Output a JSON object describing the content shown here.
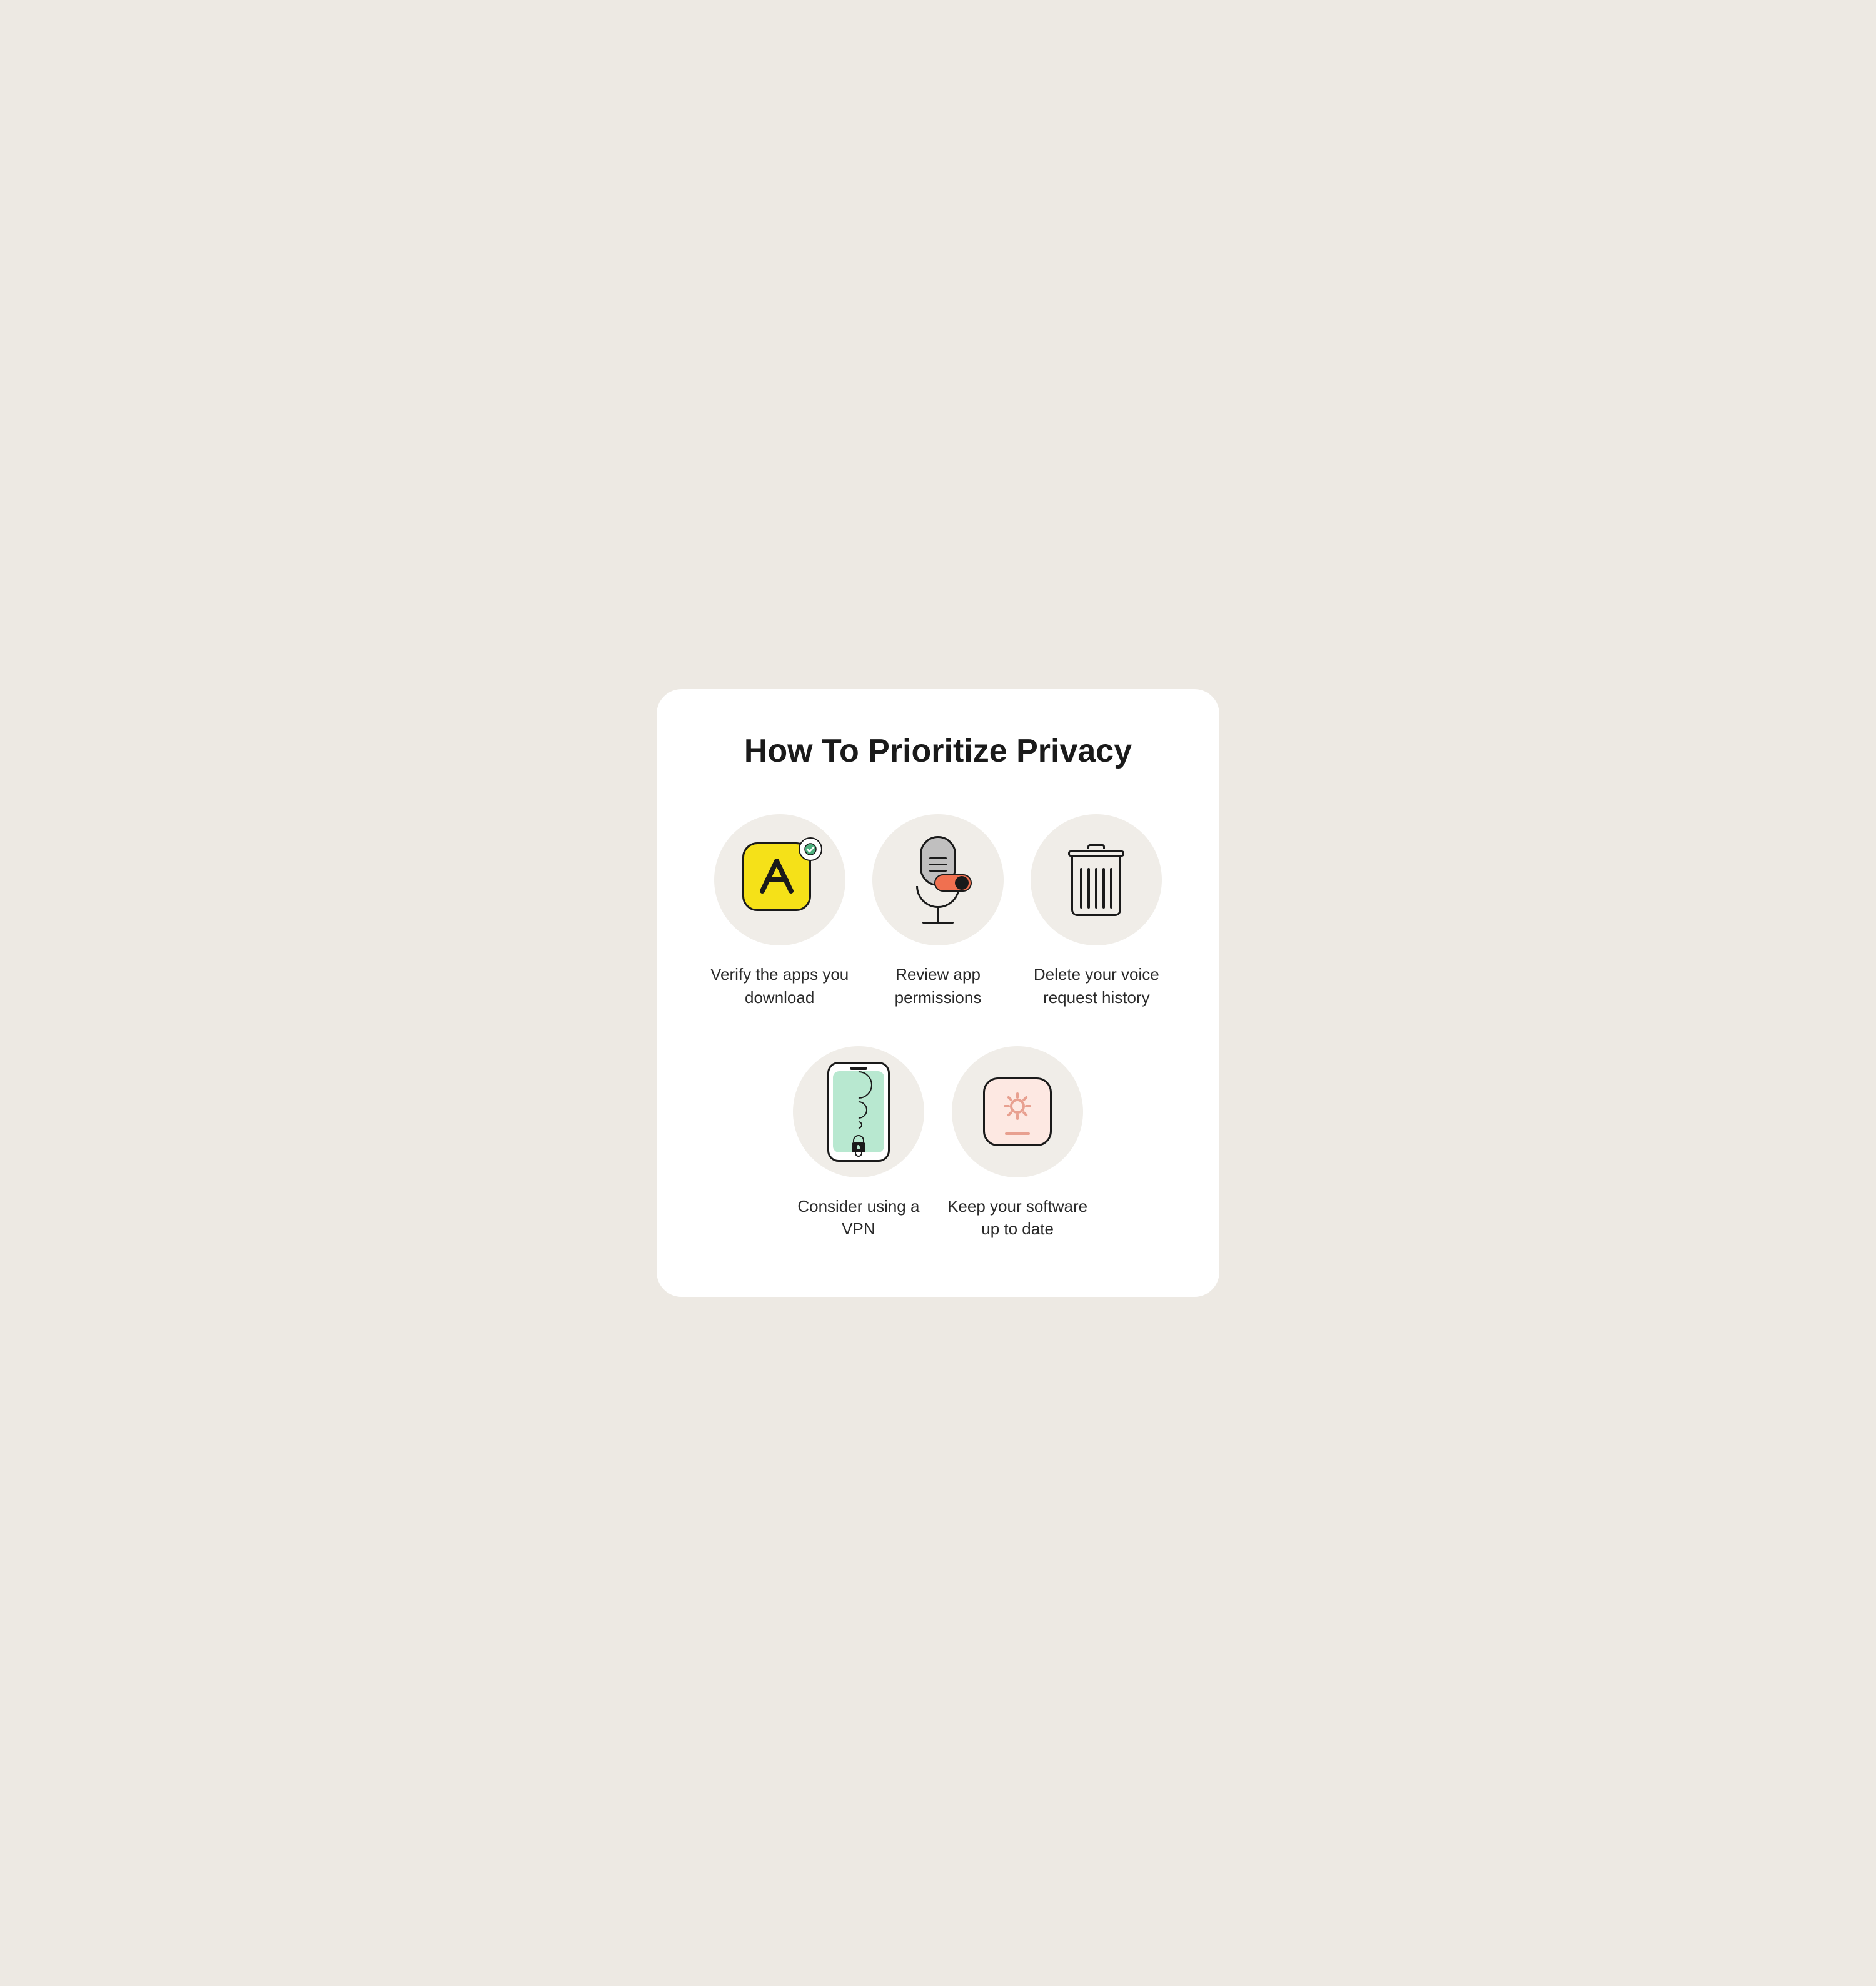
{
  "title": "How To Prioritize Privacy",
  "items_row1": [
    {
      "id": "verify-apps",
      "label": "Verify the apps you download",
      "icon_type": "appstore"
    },
    {
      "id": "review-permissions",
      "label": "Review app permissions",
      "icon_type": "microphone"
    },
    {
      "id": "delete-voice",
      "label": "Delete your voice request history",
      "icon_type": "trash"
    }
  ],
  "items_row2": [
    {
      "id": "vpn",
      "label": "Consider using a VPN",
      "icon_type": "phone"
    },
    {
      "id": "software-update",
      "label": "Keep your software up to date",
      "icon_type": "gear"
    }
  ]
}
